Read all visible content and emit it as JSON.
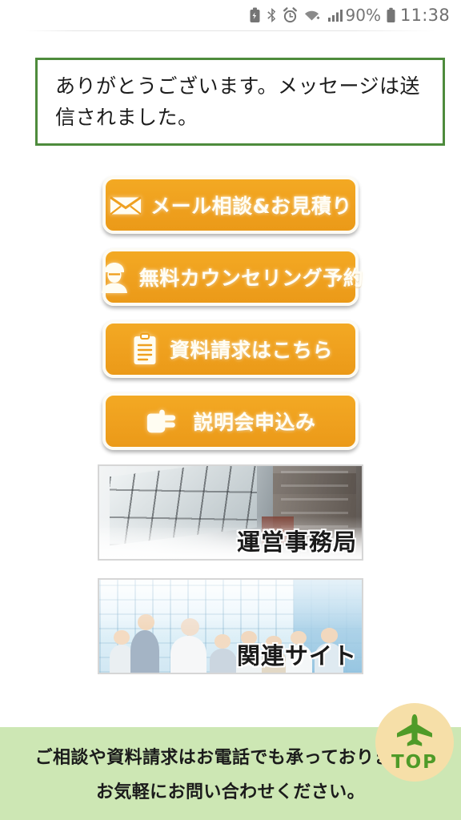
{
  "statusbar": {
    "icons": [
      "battery-saver-icon",
      "bluetooth-icon",
      "alarm-icon",
      "wifi-icon",
      "signal-icon"
    ],
    "battery_percent": "90%",
    "time": "11:38"
  },
  "message": {
    "text": "ありがとうございます。メッセージは送信されました。",
    "border_color": "#4e8b3c"
  },
  "buttons": [
    {
      "icon": "mail-icon",
      "label": "メール相談&お見積り"
    },
    {
      "icon": "counselor-icon",
      "label": "無料カウンセリング予約"
    },
    {
      "icon": "clipboard-icon",
      "label": "資料請求はこちら"
    },
    {
      "icon": "pointing-hand-icon",
      "label": "説明会申込み"
    }
  ],
  "banners": [
    {
      "image": "office-building-photo",
      "caption": "運営事務局"
    },
    {
      "image": "business-people-photo",
      "caption": "関連サイト"
    }
  ],
  "top_button": {
    "icon": "airplane-up-icon",
    "label": "TOP"
  },
  "footer": {
    "line1": "ご相談や資料請求はお電話でも承っております。",
    "line2": "お気軽にお問い合わせください。",
    "background_color": "#cde7b4"
  },
  "theme": {
    "accent_orange": "#efa01e",
    "green_footer": "#cde7b4",
    "green_border": "#4e8b3c",
    "top_button_bg": "#f6dfa8",
    "top_button_fg": "#4f9b28"
  }
}
